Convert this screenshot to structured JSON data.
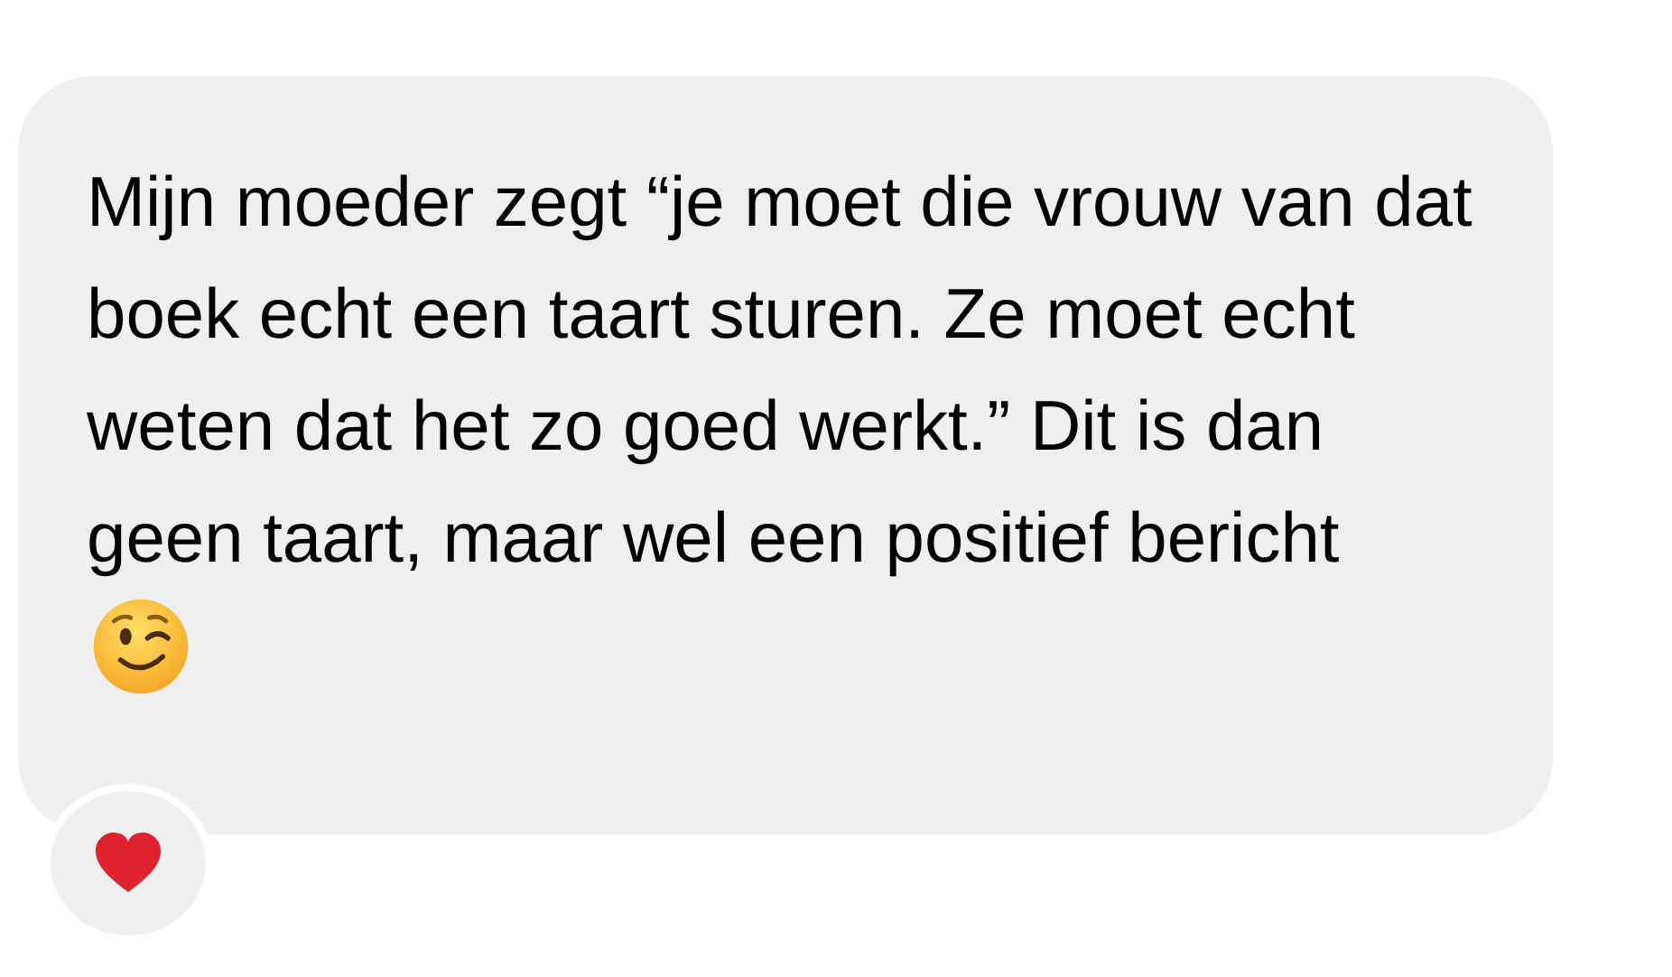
{
  "message": {
    "text": "Mijn moeder zegt “je moet die vrouw van dat boek echt een taart sturen. Ze moet echt weten dat het zo goed werkt.” Dit is dan geen taart, maar wel een positief bericht"
  }
}
